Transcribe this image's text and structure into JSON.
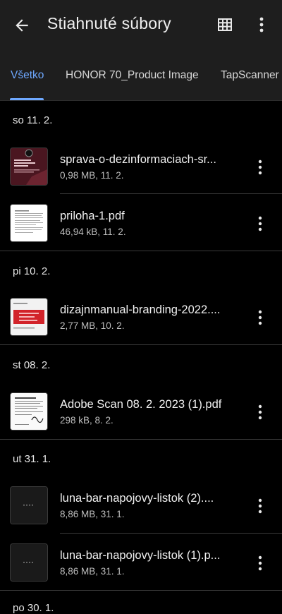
{
  "header": {
    "title": "Stiahnuté súbory",
    "icons": {
      "back": "arrow-back-icon",
      "view": "grid-view-icon",
      "more": "more-vert-icon"
    }
  },
  "tabs": [
    {
      "label": "Všetko",
      "active": true
    },
    {
      "label": "HONOR 70_Product Image",
      "active": false
    },
    {
      "label": "TapScanner",
      "active": false
    }
  ],
  "sections": [
    {
      "label": "so 11. 2.",
      "files": [
        {
          "name": "sprava-o-dezinformaciach-sr...",
          "meta": "0,98 MB, 11. 2.",
          "thumb": "red-doc"
        },
        {
          "name": "priloha-1.pdf",
          "meta": "46,94 kB, 11. 2.",
          "thumb": "white-doc"
        }
      ]
    },
    {
      "label": "pi 10. 2.",
      "files": [
        {
          "name": "dizajnmanual-branding-2022....",
          "meta": "2,77 MB, 10. 2.",
          "thumb": "branding-doc"
        }
      ]
    },
    {
      "label": "st 08. 2.",
      "files": [
        {
          "name": "Adobe Scan 08. 2. 2023 (1).pdf",
          "meta": "298 kB, 8. 2.",
          "thumb": "scan-doc"
        }
      ]
    },
    {
      "label": "ut 31. 1.",
      "files": [
        {
          "name": "luna-bar-napojovy-listok (2)....",
          "meta": "8,86 MB, 31. 1.",
          "thumb": "dark-doc"
        },
        {
          "name": "luna-bar-napojovy-listok (1).p...",
          "meta": "8,86 MB, 31. 1.",
          "thumb": "dark-doc"
        }
      ]
    },
    {
      "label": "po 30. 1.",
      "files": []
    }
  ],
  "colors": {
    "accent": "#6ea8ff",
    "background": "#000000",
    "appbar": "#1e1e1e"
  }
}
